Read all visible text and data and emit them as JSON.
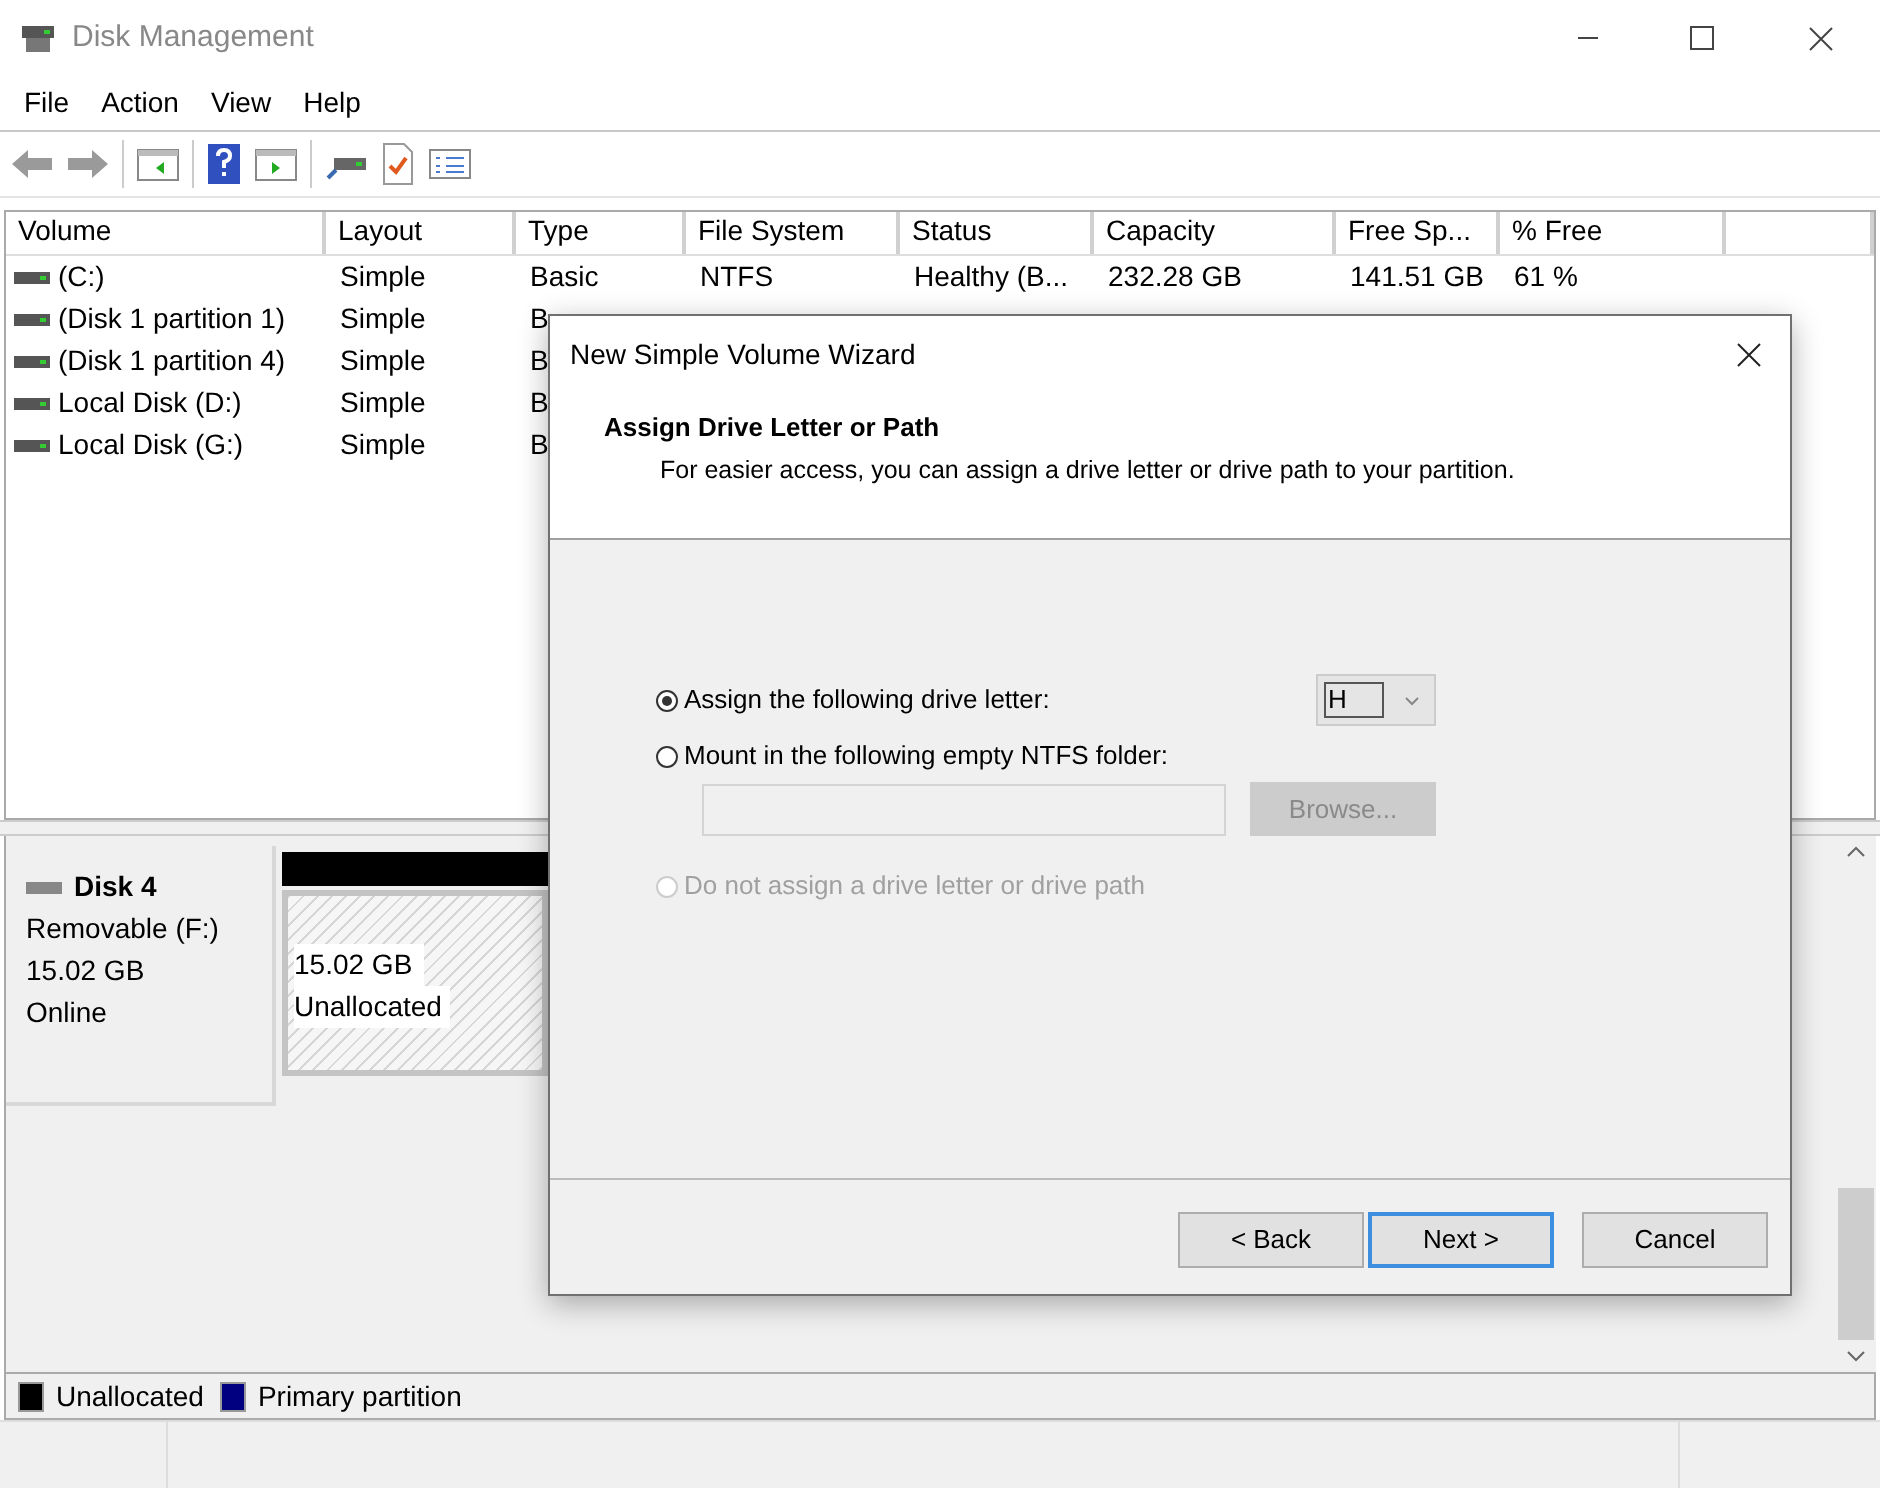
{
  "window": {
    "title": "Disk Management"
  },
  "menu": [
    "File",
    "Action",
    "View",
    "Help"
  ],
  "volume_table": {
    "columns": [
      "Volume",
      "Layout",
      "Type",
      "File System",
      "Status",
      "Capacity",
      "Free Sp...",
      "% Free"
    ],
    "rows": [
      {
        "cells": [
          "(C:)",
          "Simple",
          "Basic",
          "NTFS",
          "Healthy (B...",
          "232.28 GB",
          "141.51 GB",
          "61 %"
        ]
      },
      {
        "cells": [
          "(Disk 1 partition 1)",
          "Simple",
          "B"
        ]
      },
      {
        "cells": [
          "(Disk 1 partition 4)",
          "Simple",
          "B"
        ]
      },
      {
        "cells": [
          "Local Disk (D:)",
          "Simple",
          "B"
        ]
      },
      {
        "cells": [
          "Local Disk (G:)",
          "Simple",
          "B"
        ]
      }
    ]
  },
  "disk": {
    "name": "Disk 4",
    "type": "Removable (F:)",
    "size": "15.02 GB",
    "status": "Online",
    "partitions": [
      {
        "size": "15.02 GB",
        "label": "Unallocated",
        "kind": "unallocated"
      }
    ]
  },
  "legend": [
    {
      "label": "Unallocated",
      "color": "#000000"
    },
    {
      "label": "Primary partition",
      "color": "#000080"
    }
  ],
  "dialog": {
    "title": "New Simple Volume Wizard",
    "heading": "Assign Drive Letter or Path",
    "description": "For easier access, you can assign a drive letter or drive path to your partition.",
    "options": [
      {
        "label": "Assign the following drive letter:",
        "selected": true,
        "disabled": false
      },
      {
        "label": "Mount in the following empty NTFS folder:",
        "selected": false,
        "disabled": false
      },
      {
        "label": "Do not assign a drive letter or drive path",
        "selected": false,
        "disabled": true
      }
    ],
    "drive_letter": "H",
    "folder_field": {
      "disabled": true
    },
    "browse": {
      "label": "Browse...",
      "disabled": true
    },
    "buttons": [
      {
        "label": "< Back",
        "focused": false
      },
      {
        "label": "Next >",
        "focused": true
      },
      {
        "label": "Cancel",
        "focused": false
      }
    ]
  }
}
